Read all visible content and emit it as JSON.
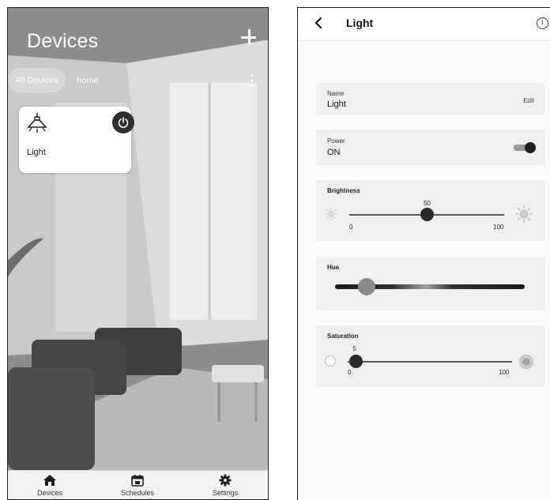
{
  "left": {
    "title": "Devices",
    "filters": [
      {
        "label": "All Devices",
        "selected": true
      },
      {
        "label": "home",
        "selected": false
      }
    ],
    "device_card": {
      "name": "Light",
      "icon": "ceiling-lamp-icon",
      "power_icon": "power-icon"
    },
    "nav": [
      {
        "label": "Devices",
        "icon": "home-icon"
      },
      {
        "label": "Schedules",
        "icon": "calendar-icon"
      },
      {
        "label": "Settings",
        "icon": "gear-icon"
      }
    ]
  },
  "right": {
    "title": "Light",
    "name_panel": {
      "label": "Name",
      "value": "Light",
      "action": "Edit"
    },
    "power_panel": {
      "label": "Power",
      "value": "ON",
      "toggle_on": true
    },
    "brightness": {
      "label": "Brightness",
      "current": "50",
      "min": "0",
      "max": "100",
      "fraction": 0.5
    },
    "hue": {
      "label": "Hue",
      "fraction": 0.12
    },
    "saturation": {
      "label": "Saturation",
      "current": "5",
      "min": "0",
      "max": "100",
      "fraction": 0.05
    }
  },
  "colors": {
    "dark": "#2b2b2b",
    "panel": "#efefef",
    "white": "#ffffff"
  }
}
